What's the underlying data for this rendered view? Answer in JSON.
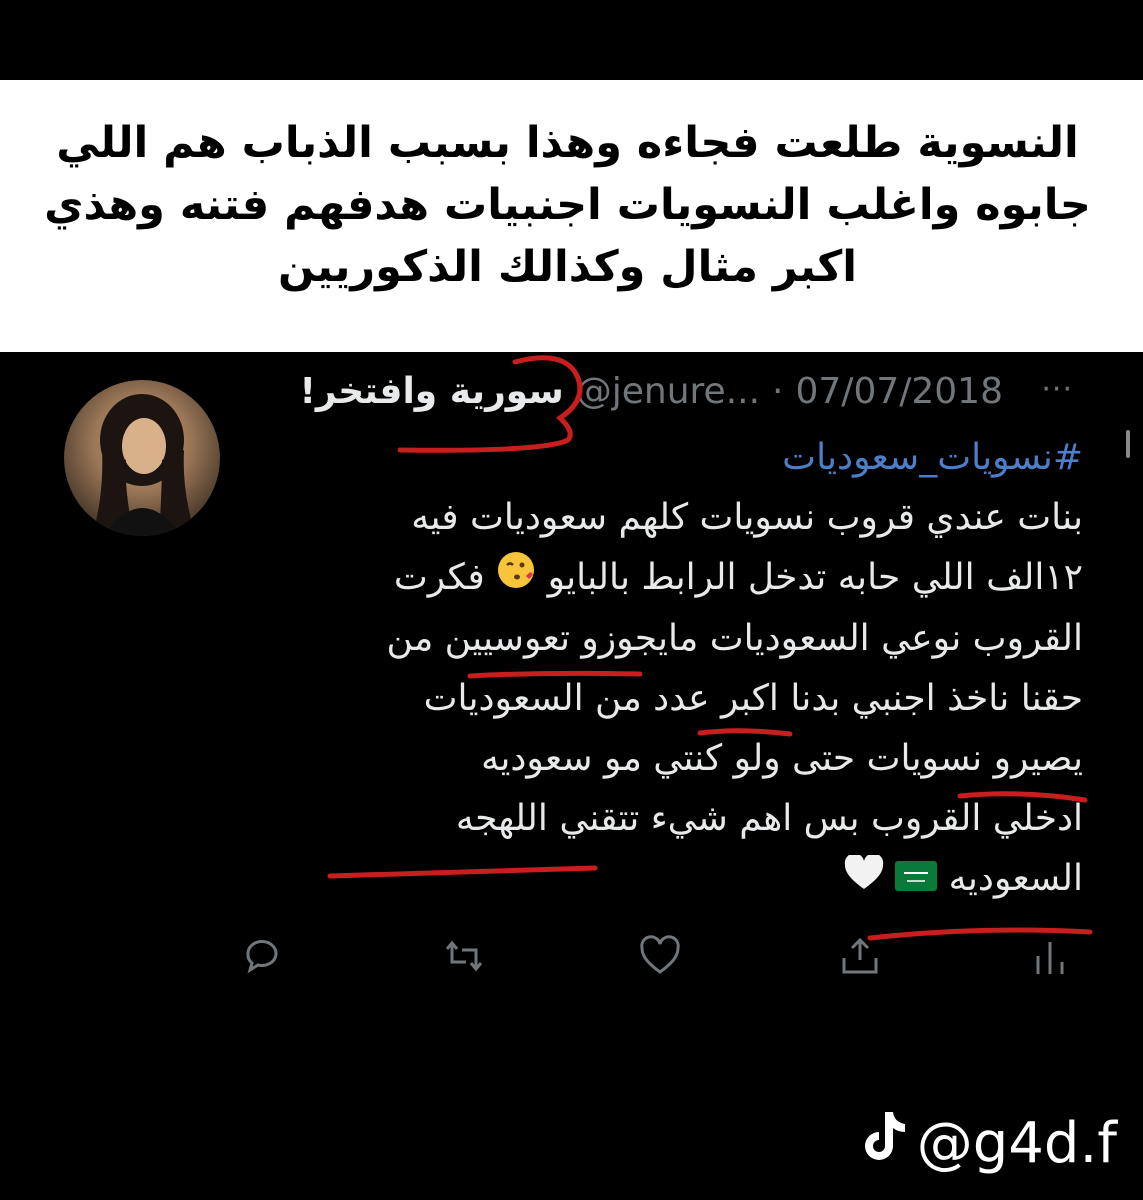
{
  "caption": {
    "lines": [
      "النسوية طلعت فجاءه وهذا بسبب الذباب هم اللي",
      "جابوه واغلب النسويات اجنبيات هدفهم فتنه وهذي",
      "اكبر مثال وكذالك الذكوريين"
    ]
  },
  "tweet": {
    "display_name": "سورية وافتخر!",
    "handle": "@jenure...",
    "separator": "·",
    "date": "07/07/2018",
    "more": "···",
    "hashtag": "#نسويات_سعوديات",
    "lines": [
      "بنات عندي قروب نسويات كلهم سعوديات فيه",
      "١٢الف اللي حابه تدخل الرابط بالبايو",
      "فكرت",
      "القروب نوعي السعوديات مايجوزو تعوسيين من",
      "حقنا ناخذ اجنبي بدنا اكبر عدد من السعوديات",
      "يصيرو نسويات حتى ولو كنتي مو سعوديه",
      "ادخلي القروب بس اهم شيء تتقني اللهجه",
      "السعوديه"
    ],
    "actions": {
      "reply": "reply-icon",
      "retweet": "retweet-icon",
      "like": "heart-icon",
      "share": "share-icon",
      "analytics": "analytics-icon"
    }
  },
  "watermark": {
    "icon": "tiktok-icon",
    "text": "@g4d.f"
  },
  "colors": {
    "background": "#000000",
    "caption_bg": "#ffffff",
    "hashtag": "#4c7ec9",
    "muted": "#71767b",
    "annotation_red": "#c81e1e"
  }
}
